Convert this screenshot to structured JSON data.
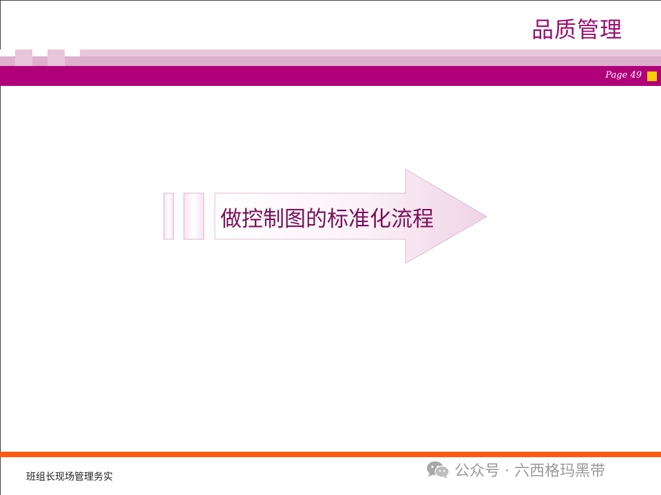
{
  "header": {
    "title": "品质管理",
    "page_label": "Page 49"
  },
  "main": {
    "arrow_text": "做控制图的标准化流程"
  },
  "footer": {
    "left_text": "班组长现场管理务实",
    "wechat_label": "公众号 · 六西格玛黑带"
  },
  "colors": {
    "title": "#9b0f6f",
    "header_band": "#b0007a",
    "band_light": "#e8c6dc",
    "accent_square": "#ffcc00",
    "footer_bar": "#ff5a12"
  },
  "icons": {
    "wechat": "wechat-icon"
  }
}
